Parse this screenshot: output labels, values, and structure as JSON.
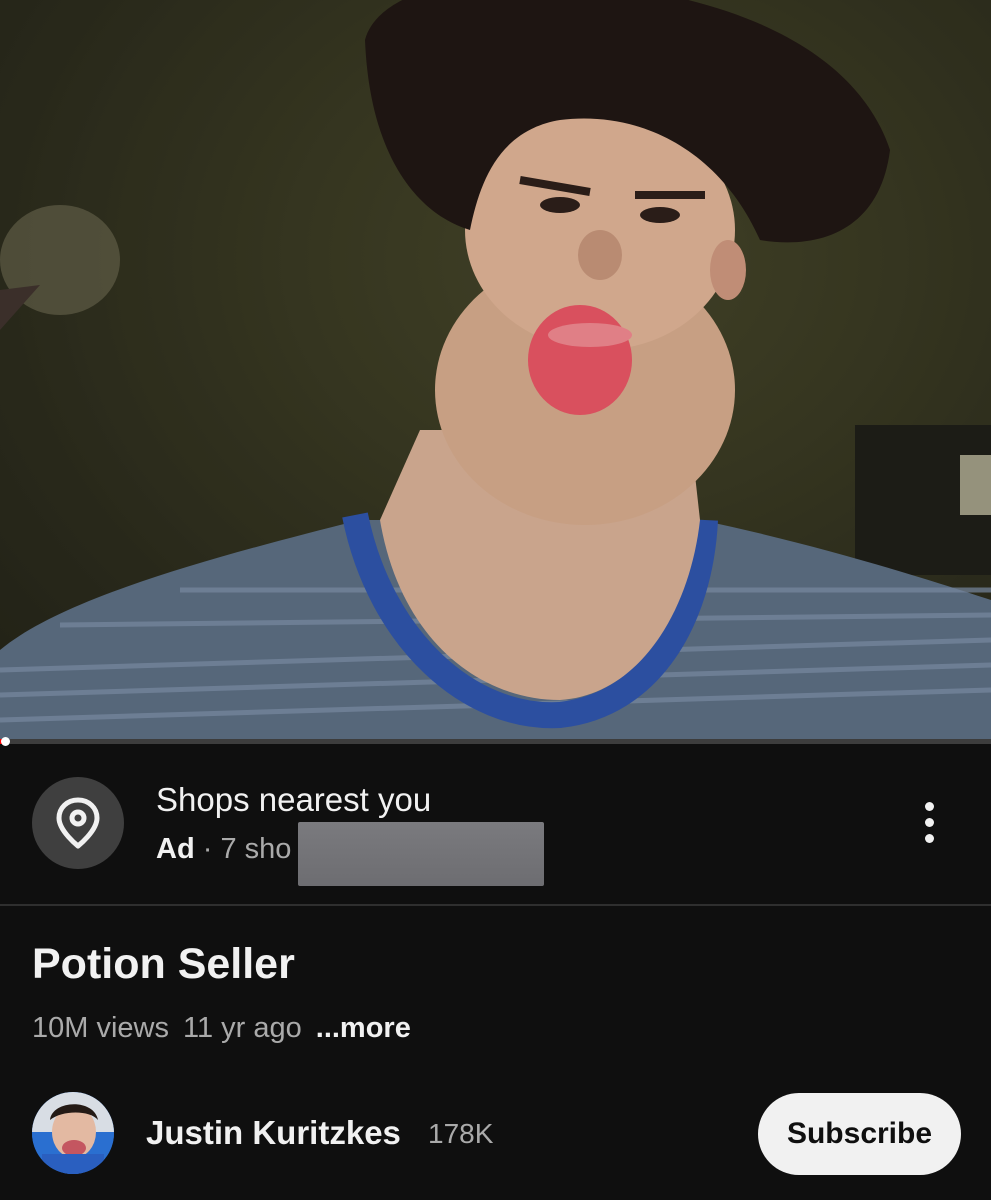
{
  "player": {
    "progress_fraction": 0.005
  },
  "ad": {
    "title": "Shops nearest you",
    "label": "Ad",
    "separator": "·",
    "subtitle_visible": "7 sho",
    "icon": "location-pin-icon"
  },
  "video": {
    "title": "Potion Seller",
    "views": "10M views",
    "age": "11 yr ago",
    "more": "...more"
  },
  "channel": {
    "name": "Justin Kuritzkes",
    "subscribers": "178K",
    "subscribe_label": "Subscribe"
  },
  "colors": {
    "background": "#0f0f0f",
    "primary_text": "#f1f1f1",
    "secondary_text": "#aaaaaa",
    "subscribe_bg": "#f1f1f1",
    "progress": "#ff0000"
  }
}
